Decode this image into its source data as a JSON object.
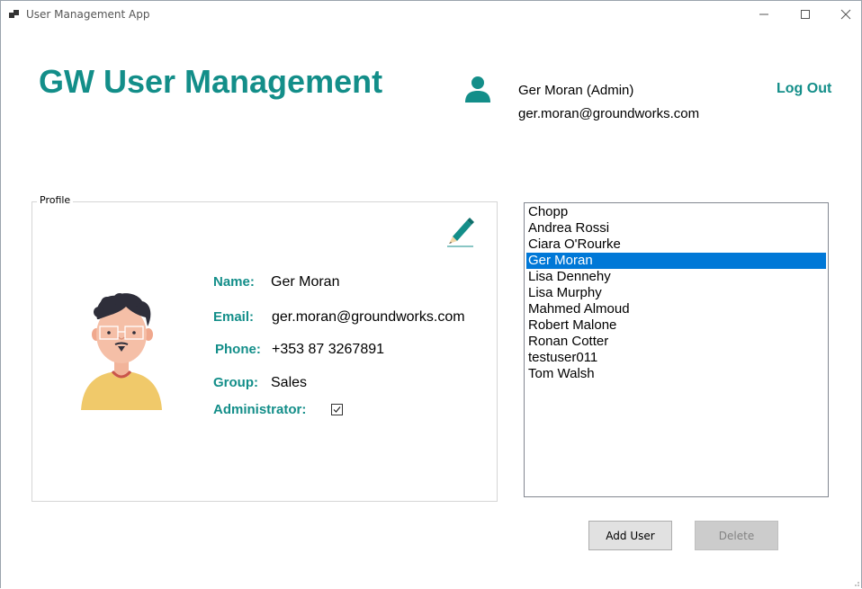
{
  "window": {
    "title": "User Management App"
  },
  "header": {
    "title": "GW User Management",
    "user_name": "Ger Moran (Admin)",
    "user_email": "ger.moran@groundworks.com",
    "logout_label": "Log Out"
  },
  "profile": {
    "legend": "Profile",
    "fields": {
      "name_label": "Name:",
      "name_value": "Ger Moran",
      "email_label": "Email:",
      "email_value": "ger.moran@groundworks.com",
      "phone_label": "Phone:",
      "phone_value": "+353 87 3267891",
      "group_label": "Group:",
      "group_value": "Sales",
      "admin_label": "Administrator:",
      "admin_checked": true
    }
  },
  "user_list": {
    "items": [
      "Chopp",
      "Andrea Rossi",
      "Ciara O'Rourke",
      "Ger Moran",
      "Lisa Dennehy",
      "Lisa Murphy",
      "Mahmed Almoud",
      "Robert Malone",
      "Ronan Cotter",
      "testuser011",
      "Tom Walsh"
    ],
    "selected_index": 3
  },
  "buttons": {
    "add_label": "Add User",
    "delete_label": "Delete",
    "delete_enabled": false
  },
  "colors": {
    "accent": "#138e89",
    "selection": "#0078d7"
  },
  "icons": {
    "app": "app-icon",
    "user": "user-icon",
    "edit": "pen-icon",
    "avatar": "avatar-illustration"
  }
}
